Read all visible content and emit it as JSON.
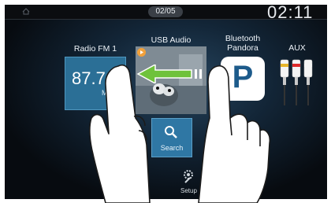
{
  "status_bar": {
    "page_indicator": "02/05",
    "clock": "02:11"
  },
  "tiles": {
    "radio": {
      "label": "Radio FM 1",
      "frequency": "87.7",
      "unit": "MHz"
    },
    "usb": {
      "label": "USB Audio"
    },
    "bluetooth": {
      "label_line1": "Bluetooth",
      "label_line2": "Pandora",
      "icon_letter": "P"
    },
    "aux": {
      "label": "AUX"
    }
  },
  "bottom": {
    "search_label": "Search",
    "setup_label": "Setup"
  },
  "colors": {
    "accent_blue": "#2f77a4",
    "swipe_arrow": "#6fc23b",
    "usb_play_badge": "#f2a13a"
  },
  "gesture": {
    "direction": "swipe-left"
  }
}
